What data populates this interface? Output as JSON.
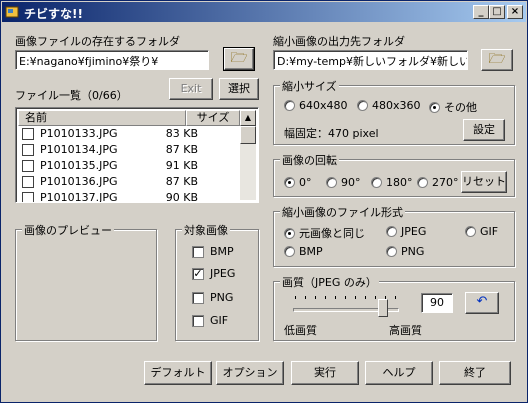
{
  "window": {
    "title": "チビすな!!"
  },
  "titlebar": {
    "min": "_",
    "max": "□",
    "close": "×"
  },
  "source": {
    "label": "画像ファイルの存在するフォルダ",
    "path": "E:¥nagano¥fjimino¥祭り¥",
    "browse_icon": "folder-open-icon"
  },
  "output": {
    "label": "縮小画像の出力先フォルダ",
    "path": "D:¥my-temp¥新しいフォルダ¥新しいフォル",
    "browse_icon": "folder-open-icon"
  },
  "filelist": {
    "label": "ファイル一覧（0/66）",
    "exit_label": "Exit",
    "select_label": "選択",
    "columns": [
      "名前",
      "サイズ"
    ],
    "rows": [
      {
        "name": "P1010133.JPG",
        "size": "83 KB"
      },
      {
        "name": "P1010134.JPG",
        "size": "87 KB"
      },
      {
        "name": "P1010135.JPG",
        "size": "91 KB"
      },
      {
        "name": "P1010136.JPG",
        "size": "87 KB"
      },
      {
        "name": "P1010137.JPG",
        "size": "90 KB"
      }
    ]
  },
  "preview": {
    "label": "画像のプレビュー"
  },
  "target": {
    "label": "対象画像",
    "items": [
      {
        "label": "BMP",
        "checked": false
      },
      {
        "label": "JPEG",
        "checked": true
      },
      {
        "label": "PNG",
        "checked": false
      },
      {
        "label": "GIF",
        "checked": false
      }
    ]
  },
  "size": {
    "label": "縮小サイズ",
    "options": [
      "640x480",
      "480x360",
      "その他"
    ],
    "selected": "その他",
    "fixed_width": "幅固定：470 pixel",
    "settings_label": "設定"
  },
  "rotation": {
    "label": "画像の回転",
    "options": [
      "0°",
      "90°",
      "180°",
      "270°"
    ],
    "selected": "0°",
    "reset_label": "リセット"
  },
  "format": {
    "label": "縮小画像のファイル形式",
    "options": [
      "元画像と同じ",
      "JPEG",
      "GIF",
      "BMP",
      "PNG"
    ],
    "selected": "元画像と同じ"
  },
  "quality": {
    "label": "画質（JPEG のみ）",
    "value": "90",
    "slider_level": 0.9,
    "low_label": "低画質",
    "high_label": "高画質",
    "undo_icon": "undo-arrow-icon"
  },
  "footer": {
    "default_label": "デフォルト",
    "options_label": "オプション",
    "run_label": "実行",
    "help_label": "ヘルプ",
    "quit_label": "終了"
  }
}
